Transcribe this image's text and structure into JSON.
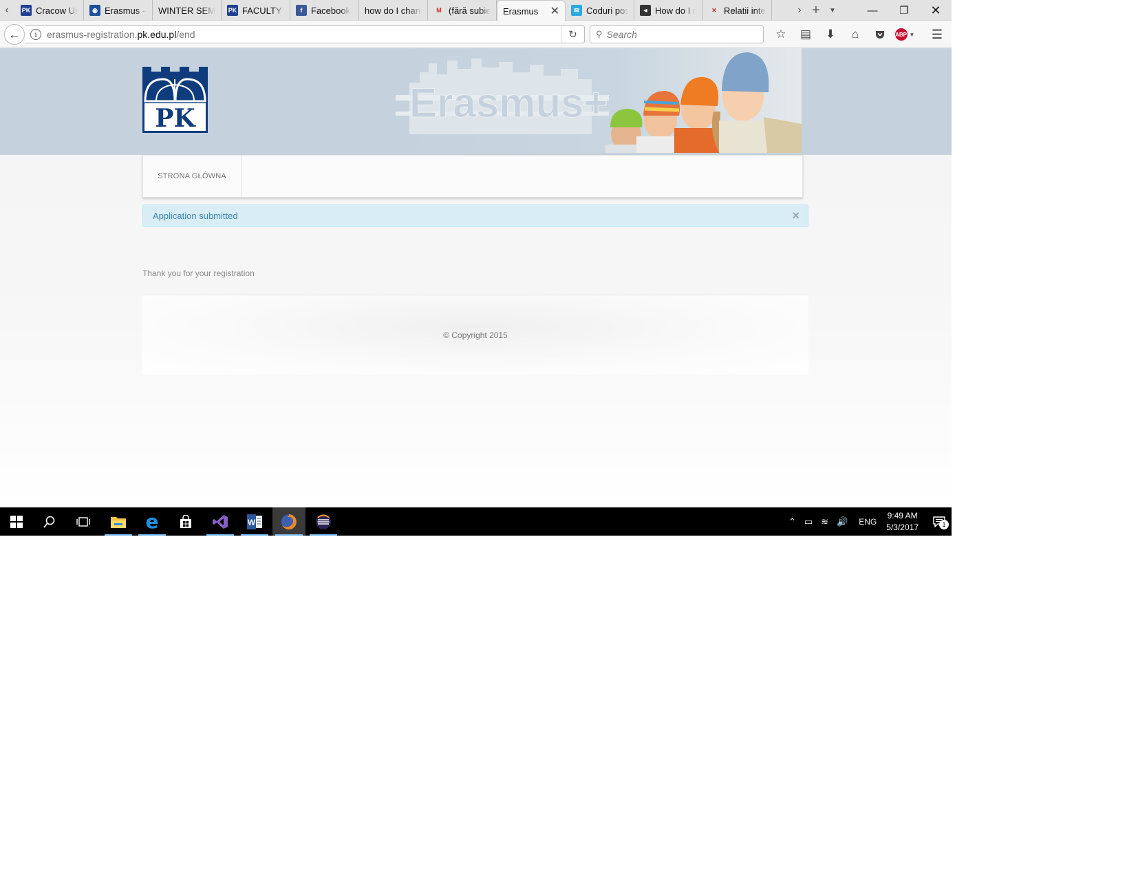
{
  "tabs": [
    {
      "title": "Cracow Un",
      "favicon": "pk-favicon",
      "color": "#1f3f8f"
    },
    {
      "title": "Erasmus - i",
      "favicon": "globe-favicon",
      "color": "#1b4f9a"
    },
    {
      "title": "WINTER SEMES",
      "favicon": "none",
      "color": ""
    },
    {
      "title": "FACULTY O",
      "favicon": "pk-favicon",
      "color": "#1f3f8f"
    },
    {
      "title": "Facebook",
      "favicon": "facebook-favicon",
      "color": "#3b5998"
    },
    {
      "title": "how do I chang",
      "favicon": "none",
      "color": ""
    },
    {
      "title": "(fără subiec",
      "favicon": "gmail-favicon",
      "color": "#d93025"
    },
    {
      "title": "Erasmus",
      "favicon": "none",
      "color": "",
      "active": true
    },
    {
      "title": "Coduri pos",
      "favicon": "mail-favicon",
      "color": "#2ca7e0"
    },
    {
      "title": "How do I r",
      "favicon": "vs-favicon",
      "color": "#333333"
    },
    {
      "title": "Relatii inter",
      "favicon": "bookmark-favicon",
      "color": "#c62828"
    }
  ],
  "address_bar": {
    "prefix": "erasmus-registration.",
    "domain": "pk.edu.pl",
    "path": "/end"
  },
  "search": {
    "placeholder": "Search"
  },
  "toolbar": {
    "abp_label": "ABP"
  },
  "logo": {
    "text": "PK",
    "color": "#0f3c7d"
  },
  "banner": {
    "text": "Erasmus+"
  },
  "nav": {
    "home_label": "STRONA GŁÓWNA"
  },
  "alert": {
    "message": "Application submitted",
    "close": "×"
  },
  "content": {
    "thank_you": "Thank you for your registration"
  },
  "footer": {
    "copyright": "© Copyright 2015"
  },
  "taskbar": {
    "apps": [
      "start",
      "search",
      "task-view",
      "file-explorer",
      "edge",
      "store",
      "visual-studio",
      "word",
      "firefox",
      "eclipse"
    ],
    "lang": "ENG",
    "time": "9:49 AM",
    "date": "5/3/2017",
    "notifications": "1"
  }
}
